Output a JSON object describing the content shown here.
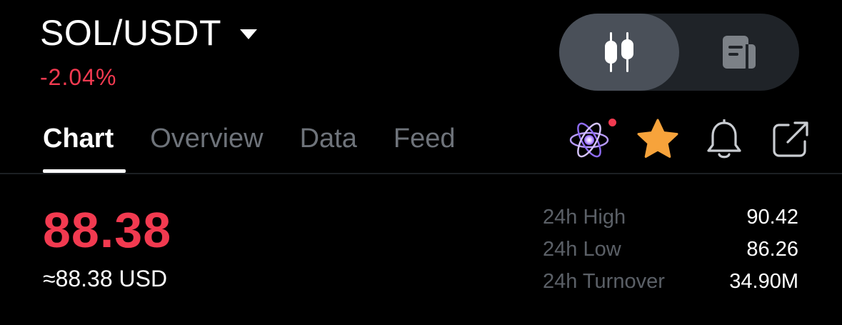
{
  "header": {
    "pair": "SOL/USDT",
    "change_percent": "-2.04%"
  },
  "view_toggle": {
    "active": "chart-view-icon",
    "inactive": "info-view-icon"
  },
  "tabs": [
    {
      "label": "Chart",
      "active": true
    },
    {
      "label": "Overview",
      "active": false
    },
    {
      "label": "Data",
      "active": false
    },
    {
      "label": "Feed",
      "active": false
    }
  ],
  "actions": {
    "ai_icon": "atom-icon",
    "favorite_icon": "star-icon",
    "alert_icon": "bell-icon",
    "share_icon": "share-icon",
    "ai_has_notification": true
  },
  "price": {
    "last": "88.38",
    "usd_equivalent": "≈88.38 USD"
  },
  "stats": [
    {
      "label": "24h High",
      "value": "90.42"
    },
    {
      "label": "24h Low",
      "value": "86.26"
    },
    {
      "label": "24h Turnover",
      "value": "34.90M"
    }
  ],
  "colors": {
    "negative": "#f23a50",
    "favorite": "#f7a33b",
    "background": "#000000",
    "muted_text": "#6e737a"
  }
}
